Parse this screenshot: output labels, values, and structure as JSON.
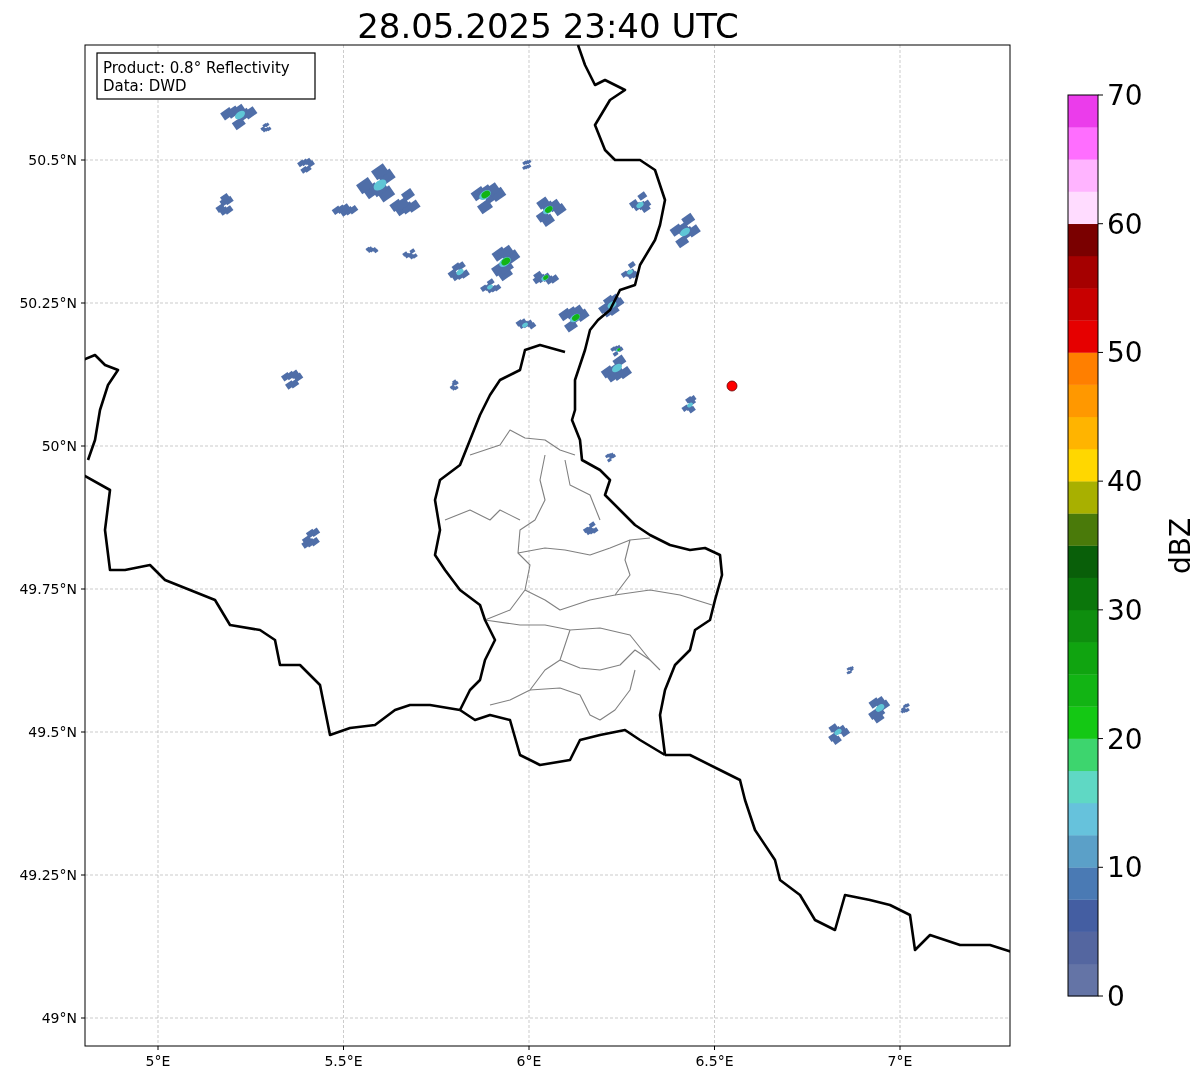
{
  "title": "28.05.2025 23:40 UTC",
  "map": {
    "info_box": {
      "lines": [
        "Product: 0.8° Reflectivity",
        "Data: DWD"
      ]
    },
    "y_ticks": [
      "50.5°N",
      "50.25°N",
      "50°N",
      "49.75°N",
      "49.5°N",
      "49.25°N",
      "49°N"
    ],
    "x_ticks": [
      "5°E",
      "5.5°E",
      "6°E",
      "6.5°E",
      "7°E"
    ]
  },
  "colorbar": {
    "label": "dBZ",
    "ticks": [
      "70",
      "60",
      "50",
      "40",
      "30",
      "20",
      "10",
      "0"
    ],
    "segments": [
      {
        "color": "#6474a6"
      },
      {
        "color": "#5466a0"
      },
      {
        "color": "#445ea2"
      },
      {
        "color": "#4a7ab4"
      },
      {
        "color": "#5ba0c8"
      },
      {
        "color": "#66c2dc"
      },
      {
        "color": "#5fd8c4"
      },
      {
        "color": "#3dd56e"
      },
      {
        "color": "#14c814"
      },
      {
        "color": "#12b414"
      },
      {
        "color": "#10a410"
      },
      {
        "color": "#0e8e0e"
      },
      {
        "color": "#0b760b"
      },
      {
        "color": "#095f09"
      },
      {
        "color": "#4a7a0a"
      },
      {
        "color": "#a8b000"
      },
      {
        "color": "#ffd700"
      },
      {
        "color": "#ffb400"
      },
      {
        "color": "#ff9800"
      },
      {
        "color": "#ff7f00"
      },
      {
        "color": "#e60000"
      },
      {
        "color": "#c80000"
      },
      {
        "color": "#a50000"
      },
      {
        "color": "#7a0000"
      },
      {
        "color": "#ffdcff"
      },
      {
        "color": "#ffb4ff"
      },
      {
        "color": "#ff6eff"
      },
      {
        "color": "#eb3ceb"
      }
    ]
  }
}
